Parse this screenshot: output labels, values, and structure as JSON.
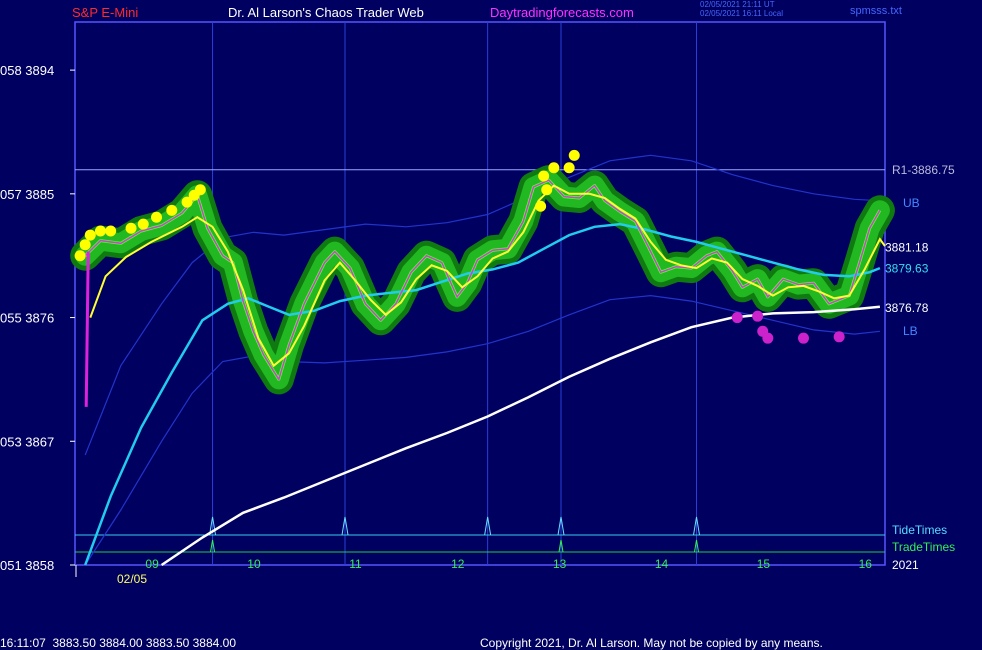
{
  "header": {
    "symbol": "S&P E-Mini",
    "title": "Dr. Al Larson's Chaos Trader Web",
    "site": "Daytradingforecasts.com",
    "timestamp_ut": "02/05/2021 21:11 UT",
    "timestamp_local": "02/05/2021 16:11 Local",
    "file": "spmsss.txt"
  },
  "footer": {
    "quote": "16:11:07  3883.50 3884.00 3883.50 3884.00",
    "copyright": "Copyright 2021, Dr. Al Larson. May not be copied by any means."
  },
  "chart_data": {
    "type": "line",
    "y_ticks": [
      {
        "label": "058  3894",
        "value": 3894
      },
      {
        "label": "057  3885",
        "value": 3885
      },
      {
        "label": "055  3876",
        "value": 3876
      },
      {
        "label": "053  3867",
        "value": 3867
      },
      {
        "label": "051  3858",
        "value": 3858
      }
    ],
    "x_ticks": [
      {
        "label": "09",
        "hour": 9.0
      },
      {
        "label": "10",
        "hour": 10.0
      },
      {
        "label": "11",
        "hour": 11.0
      },
      {
        "label": "12",
        "hour": 12.0
      },
      {
        "label": "13",
        "hour": 13.0
      },
      {
        "label": "14",
        "hour": 14.0
      },
      {
        "label": "15",
        "hour": 15.0
      },
      {
        "label": "16",
        "hour": 16.0
      }
    ],
    "date_label": "02/05",
    "year_label": "2021",
    "x_range": [
      8.25,
      16.2
    ],
    "y_range": [
      3858,
      3897.5
    ],
    "tide_times": [
      9.6,
      10.9,
      12.3,
      13.02,
      14.35
    ],
    "trade_times": [
      9.6,
      13.02,
      14.35
    ],
    "tide_label": "TideTimes",
    "trade_label": "TradeTimes",
    "resistance": {
      "label": "R1-3886.75",
      "value": 3886.75
    },
    "right_labels": [
      {
        "text": "UB",
        "value": 3884.4,
        "color": "#4488ff"
      },
      {
        "text": "3881.18",
        "value": 3881.18,
        "color": "#ffffff"
      },
      {
        "text": "3879.63",
        "value": 3879.63,
        "color": "#33ddee"
      },
      {
        "text": "3876.78",
        "value": 3876.78,
        "color": "#ffffff"
      },
      {
        "text": "LB",
        "value": 3875.1,
        "color": "#4488ff"
      }
    ],
    "series": {
      "price": [
        [
          8.35,
          3880.5
        ],
        [
          8.5,
          3881.6
        ],
        [
          8.7,
          3881.4
        ],
        [
          8.9,
          3882.3
        ],
        [
          9.1,
          3882.7
        ],
        [
          9.3,
          3883.6
        ],
        [
          9.45,
          3884.9
        ],
        [
          9.55,
          3882.5
        ],
        [
          9.7,
          3880.5
        ],
        [
          9.8,
          3880.0
        ],
        [
          9.9,
          3877.2
        ],
        [
          10.0,
          3875.0
        ],
        [
          10.1,
          3873.3
        ],
        [
          10.25,
          3871.5
        ],
        [
          10.35,
          3874.0
        ],
        [
          10.5,
          3877.0
        ],
        [
          10.7,
          3880.0
        ],
        [
          10.8,
          3880.8
        ],
        [
          10.95,
          3879.6
        ],
        [
          11.1,
          3877.0
        ],
        [
          11.25,
          3875.8
        ],
        [
          11.4,
          3877.0
        ],
        [
          11.55,
          3879.3
        ],
        [
          11.7,
          3880.5
        ],
        [
          11.85,
          3880.0
        ],
        [
          12.0,
          3877.5
        ],
        [
          12.1,
          3878.5
        ],
        [
          12.2,
          3880.2
        ],
        [
          12.35,
          3880.9
        ],
        [
          12.5,
          3881.0
        ],
        [
          12.65,
          3883.0
        ],
        [
          12.75,
          3885.5
        ],
        [
          12.9,
          3886.0
        ],
        [
          13.05,
          3884.8
        ],
        [
          13.2,
          3884.7
        ],
        [
          13.35,
          3885.6
        ],
        [
          13.45,
          3884.5
        ],
        [
          13.6,
          3883.7
        ],
        [
          13.75,
          3883.0
        ],
        [
          13.9,
          3880.8
        ],
        [
          14.0,
          3879.3
        ],
        [
          14.15,
          3879.7
        ],
        [
          14.3,
          3879.6
        ],
        [
          14.45,
          3880.5
        ],
        [
          14.55,
          3880.8
        ],
        [
          14.7,
          3879.4
        ],
        [
          14.8,
          3878.2
        ],
        [
          14.95,
          3878.8
        ],
        [
          15.05,
          3877.5
        ],
        [
          15.2,
          3878.8
        ],
        [
          15.35,
          3878.4
        ],
        [
          15.5,
          3878.5
        ],
        [
          15.65,
          3877.0
        ],
        [
          15.85,
          3877.6
        ],
        [
          15.95,
          3880.0
        ],
        [
          16.05,
          3882.5
        ],
        [
          16.15,
          3883.8
        ]
      ],
      "yellow_ma": [
        [
          8.4,
          3876.0
        ],
        [
          8.55,
          3879.0
        ],
        [
          8.75,
          3880.4
        ],
        [
          9.0,
          3881.5
        ],
        [
          9.3,
          3882.6
        ],
        [
          9.45,
          3883.3
        ],
        [
          9.6,
          3882.6
        ],
        [
          9.75,
          3880.8
        ],
        [
          9.9,
          3878.0
        ],
        [
          10.05,
          3874.5
        ],
        [
          10.2,
          3872.5
        ],
        [
          10.35,
          3873.4
        ],
        [
          10.5,
          3875.4
        ],
        [
          10.7,
          3878.7
        ],
        [
          10.85,
          3880.0
        ],
        [
          11.0,
          3878.7
        ],
        [
          11.15,
          3877.3
        ],
        [
          11.3,
          3876.2
        ],
        [
          11.45,
          3877.1
        ],
        [
          11.6,
          3878.8
        ],
        [
          11.75,
          3879.8
        ],
        [
          11.9,
          3879.4
        ],
        [
          12.05,
          3878.2
        ],
        [
          12.2,
          3879.0
        ],
        [
          12.35,
          3880.3
        ],
        [
          12.5,
          3880.8
        ],
        [
          12.65,
          3882.2
        ],
        [
          12.8,
          3884.5
        ],
        [
          12.95,
          3885.6
        ],
        [
          13.1,
          3885.0
        ],
        [
          13.3,
          3885.0
        ],
        [
          13.45,
          3884.7
        ],
        [
          13.6,
          3883.9
        ],
        [
          13.75,
          3883.2
        ],
        [
          13.9,
          3881.5
        ],
        [
          14.05,
          3880.2
        ],
        [
          14.2,
          3879.8
        ],
        [
          14.35,
          3879.6
        ],
        [
          14.5,
          3880.3
        ],
        [
          14.65,
          3880.0
        ],
        [
          14.8,
          3878.8
        ],
        [
          14.95,
          3878.3
        ],
        [
          15.1,
          3877.6
        ],
        [
          15.25,
          3878.2
        ],
        [
          15.4,
          3878.3
        ],
        [
          15.55,
          3877.9
        ],
        [
          15.7,
          3877.4
        ],
        [
          15.85,
          3877.6
        ],
        [
          16.0,
          3879.5
        ],
        [
          16.15,
          3881.7
        ],
        [
          16.2,
          3881.2
        ]
      ],
      "cyan_ma": [
        [
          8.35,
          3858.0
        ],
        [
          8.6,
          3863.0
        ],
        [
          8.9,
          3868.0
        ],
        [
          9.2,
          3872.0
        ],
        [
          9.5,
          3875.8
        ],
        [
          9.75,
          3877.0
        ],
        [
          9.95,
          3877.4
        ],
        [
          10.15,
          3876.8
        ],
        [
          10.35,
          3876.2
        ],
        [
          10.6,
          3876.5
        ],
        [
          10.85,
          3877.2
        ],
        [
          11.1,
          3877.6
        ],
        [
          11.35,
          3877.8
        ],
        [
          11.6,
          3878.0
        ],
        [
          11.85,
          3878.6
        ],
        [
          12.1,
          3879.2
        ],
        [
          12.35,
          3879.5
        ],
        [
          12.6,
          3880.0
        ],
        [
          12.85,
          3881.0
        ],
        [
          13.1,
          3882.0
        ],
        [
          13.35,
          3882.6
        ],
        [
          13.6,
          3882.8
        ],
        [
          13.85,
          3882.4
        ],
        [
          14.1,
          3881.9
        ],
        [
          14.35,
          3881.5
        ],
        [
          14.6,
          3881.0
        ],
        [
          14.85,
          3880.5
        ],
        [
          15.1,
          3880.0
        ],
        [
          15.35,
          3879.5
        ],
        [
          15.6,
          3879.1
        ],
        [
          15.85,
          3879.0
        ],
        [
          16.05,
          3879.3
        ],
        [
          16.15,
          3879.6
        ]
      ],
      "white_ma": [
        [
          9.1,
          3858.0
        ],
        [
          9.5,
          3860.0
        ],
        [
          9.9,
          3861.8
        ],
        [
          10.3,
          3862.9
        ],
        [
          10.7,
          3864.1
        ],
        [
          11.1,
          3865.3
        ],
        [
          11.5,
          3866.5
        ],
        [
          11.9,
          3867.6
        ],
        [
          12.3,
          3868.8
        ],
        [
          12.7,
          3870.2
        ],
        [
          13.1,
          3871.7
        ],
        [
          13.5,
          3873.0
        ],
        [
          13.9,
          3874.2
        ],
        [
          14.3,
          3875.3
        ],
        [
          14.7,
          3876.0
        ],
        [
          15.1,
          3876.3
        ],
        [
          15.5,
          3876.4
        ],
        [
          15.9,
          3876.6
        ],
        [
          16.15,
          3876.78
        ]
      ],
      "upper_band": [
        [
          8.35,
          3866.0
        ],
        [
          8.7,
          3872.5
        ],
        [
          9.1,
          3877.0
        ],
        [
          9.4,
          3880.0
        ],
        [
          9.7,
          3881.8
        ],
        [
          10.0,
          3882.2
        ],
        [
          10.3,
          3882.0
        ],
        [
          10.7,
          3882.4
        ],
        [
          11.1,
          3882.8
        ],
        [
          11.5,
          3882.6
        ],
        [
          11.9,
          3882.9
        ],
        [
          12.3,
          3883.5
        ],
        [
          12.7,
          3884.8
        ],
        [
          13.1,
          3886.2
        ],
        [
          13.5,
          3887.4
        ],
        [
          13.9,
          3887.8
        ],
        [
          14.3,
          3887.4
        ],
        [
          14.7,
          3886.4
        ],
        [
          15.1,
          3885.6
        ],
        [
          15.5,
          3885.0
        ],
        [
          15.9,
          3884.6
        ],
        [
          16.15,
          3884.5
        ]
      ],
      "lower_band": [
        [
          8.35,
          3858.0
        ],
        [
          8.7,
          3862.0
        ],
        [
          9.1,
          3867.0
        ],
        [
          9.4,
          3870.5
        ],
        [
          9.7,
          3872.8
        ],
        [
          10.0,
          3873.2
        ],
        [
          10.3,
          3872.8
        ],
        [
          10.7,
          3872.7
        ],
        [
          11.1,
          3872.9
        ],
        [
          11.5,
          3873.1
        ],
        [
          11.9,
          3873.5
        ],
        [
          12.3,
          3874.1
        ],
        [
          12.7,
          3875.0
        ],
        [
          13.1,
          3876.2
        ],
        [
          13.5,
          3877.3
        ],
        [
          13.9,
          3877.6
        ],
        [
          14.3,
          3877.2
        ],
        [
          14.7,
          3876.5
        ],
        [
          15.1,
          3875.8
        ],
        [
          15.5,
          3875.1
        ],
        [
          15.9,
          3874.8
        ],
        [
          16.15,
          3875.0
        ]
      ],
      "yellow_dots": [
        [
          8.3,
          3880.5
        ],
        [
          8.35,
          3881.3
        ],
        [
          8.4,
          3882.0
        ],
        [
          8.5,
          3882.3
        ],
        [
          8.6,
          3882.3
        ],
        [
          8.8,
          3882.5
        ],
        [
          8.92,
          3882.8
        ],
        [
          9.05,
          3883.3
        ],
        [
          9.2,
          3883.8
        ],
        [
          9.35,
          3884.4
        ],
        [
          9.42,
          3884.9
        ],
        [
          9.48,
          3885.3
        ],
        [
          12.85,
          3886.3
        ],
        [
          12.95,
          3886.9
        ],
        [
          13.1,
          3886.9
        ],
        [
          13.15,
          3887.8
        ],
        [
          12.82,
          3884.1
        ],
        [
          12.88,
          3885.3
        ]
      ],
      "magenta_dots": [
        [
          14.75,
          3876.0
        ],
        [
          14.95,
          3876.1
        ],
        [
          15.0,
          3875.0
        ],
        [
          15.05,
          3874.5
        ],
        [
          15.4,
          3874.5
        ],
        [
          15.75,
          3874.6
        ]
      ]
    }
  }
}
